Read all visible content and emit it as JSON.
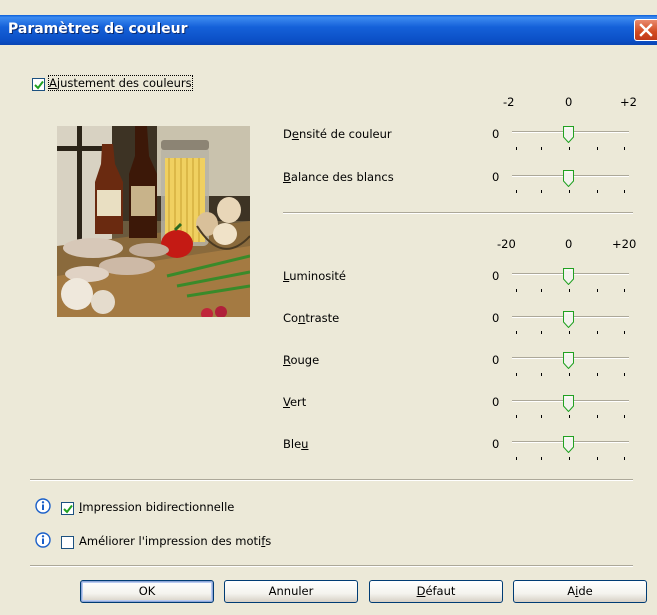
{
  "window": {
    "title": "Paramètres de couleur"
  },
  "color_adjust": {
    "label_pre": "",
    "label_mnemonic": "A",
    "label_post": "justement des couleurs",
    "checked": true
  },
  "scale_small": {
    "min": "-2",
    "mid": "0",
    "max": "+2"
  },
  "scale_large": {
    "min": "-20",
    "mid": "0",
    "max": "+20"
  },
  "sliders_top": [
    {
      "pre": "D",
      "mnemonic": "e",
      "post": "nsité de couleur",
      "value": "0",
      "level": 0
    },
    {
      "pre": "",
      "mnemonic": "B",
      "post": "alance des blancs",
      "value": "0",
      "level": 0
    }
  ],
  "sliders_bottom": [
    {
      "pre": "",
      "mnemonic": "L",
      "post": "uminosité",
      "value": "0",
      "level": 0
    },
    {
      "pre": "Co",
      "mnemonic": "n",
      "post": "traste",
      "value": "0",
      "level": 0
    },
    {
      "pre": "",
      "mnemonic": "R",
      "post": "ouge",
      "value": "0",
      "level": 0
    },
    {
      "pre": "",
      "mnemonic": "V",
      "post": "ert",
      "value": "0",
      "level": 0
    },
    {
      "pre": "Ble",
      "mnemonic": "u",
      "post": "",
      "value": "0",
      "level": 0
    }
  ],
  "options": [
    {
      "pre": "",
      "mnemonic": "I",
      "post": "mpression bidirectionnelle",
      "checked": true
    },
    {
      "pre": "Améliorer l'impression des moti",
      "mnemonic": "f",
      "post": "s",
      "checked": false
    }
  ],
  "buttons": {
    "ok": "OK",
    "cancel": "Annuler",
    "default_pre": "",
    "default_mnemonic": "D",
    "default_post": "éfaut",
    "help_pre": "A",
    "help_mnemonic": "i",
    "help_post": "de"
  },
  "colors": {
    "titlebar": "#0b4fc6",
    "background": "#ece9d8",
    "close": "#d24a20",
    "check": "#21a121",
    "info": "#1a5fc8"
  }
}
